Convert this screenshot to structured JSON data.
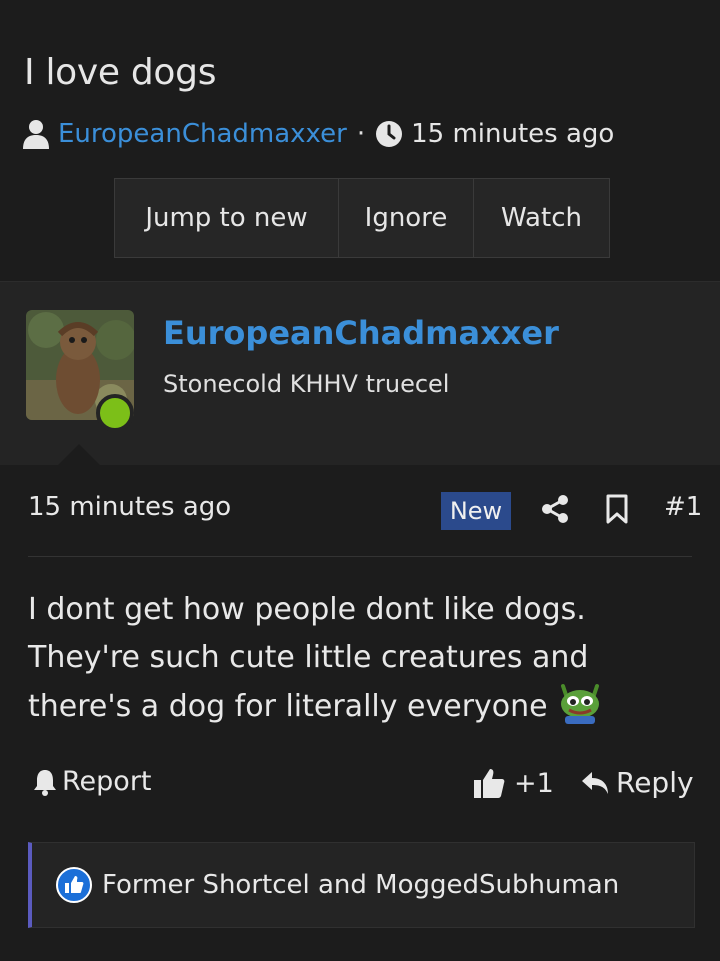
{
  "thread": {
    "title": "I love dogs",
    "author": "EuropeanChadmaxxer",
    "separator": "·",
    "time": "15 minutes ago",
    "icons": {
      "author": "user-icon",
      "time": "clock-icon"
    }
  },
  "thread_buttons": [
    {
      "label": "Jump to new"
    },
    {
      "label": "Ignore"
    },
    {
      "label": "Watch"
    }
  ],
  "post": {
    "author": "EuropeanChadmaxxer",
    "user_title": "Stonecold KHHV truecel",
    "online_status_color": "#7cbf18",
    "time": "15 minutes ago",
    "badge": "New",
    "number": "#1",
    "body": "I dont get how people dont like dogs. They're such cute little creatures and there's a dog for literally everyone",
    "emoji": "pepe-icon",
    "actions": {
      "report": "Report",
      "like_count": "+1",
      "reply": "Reply"
    },
    "reactions_text": "Former Shortcel and MoggedSubhuman"
  },
  "colors": {
    "background": "#1c1c1c",
    "link": "#3b8fd9",
    "badge": "#2b4a8c",
    "reaction_bar": "#5b5bbf"
  }
}
